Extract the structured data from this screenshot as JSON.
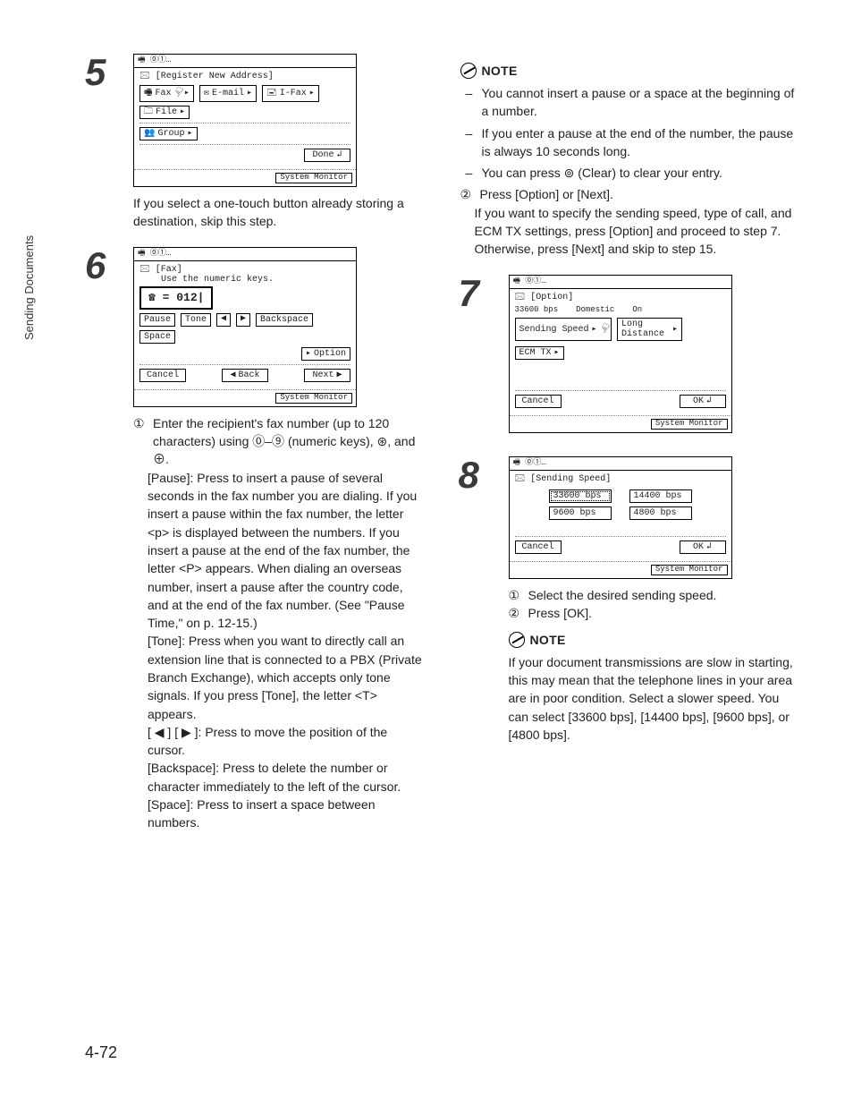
{
  "side_tab": "Sending Documents",
  "page_number": "4-72",
  "left": {
    "step5": {
      "num": "5",
      "screen_title": "[Register New Address]",
      "btn_fax": "Fax",
      "btn_email": "E-mail",
      "btn_ifax": "I-Fax",
      "btn_file": "File",
      "btn_group": "Group",
      "btn_done": "Done",
      "sysmon": "System Monitor",
      "caption": "If you select a one-touch button already storing a destination, skip this step."
    },
    "step6": {
      "num": "6",
      "screen_lbl1": "[Fax]",
      "screen_lbl2": "Use the numeric keys.",
      "dial_prefix": "☎ = ",
      "dial_value": "012",
      "btn_pause": "Pause",
      "btn_tone": "Tone",
      "btn_left": "◀",
      "btn_right": "▶",
      "btn_backspace": "Backspace",
      "btn_space": "Space",
      "btn_option": "Option",
      "btn_cancel": "Cancel",
      "btn_back": "Back",
      "btn_next": "Next",
      "sysmon": "System Monitor",
      "li1_n": "①",
      "li1": "Enter the recipient's fax number (up to 120 characters) using ⓪–⑨ (numeric keys), ⊛, and ⊕.",
      "pause_lbl": "[Pause]: Press to insert a pause of several seconds in the fax number you are dialing. If you insert a pause within the fax number, the letter <p> is displayed between the numbers. If you insert a pause at the end of the fax number, the letter <P> appears. When dialing an overseas number, insert a pause after the country code, and at the end of the fax number. (See \"Pause Time,\" on p. 12-15.)",
      "tone_lbl": "[Tone]: Press when you want to directly call an extension line that is connected to a PBX (Private Branch Exchange), which accepts only tone signals. If you press [Tone], the letter <T> appears.",
      "arrows_lbl": "[ ◀ ] [ ▶ ]: Press to move the position of the cursor.",
      "bksp_lbl": "[Backspace]: Press to delete the number or character immediately to the left of the cursor.",
      "space_lbl": "[Space]: Press to insert a space between numbers."
    }
  },
  "right": {
    "note1": {
      "label": "NOTE",
      "d1": "You cannot insert a pause or a space at the beginning of a number.",
      "d2": "If you enter a pause at the end of the number, the pause is always 10 seconds long.",
      "d3": "You can press ⊚ (Clear) to clear your entry."
    },
    "li2_n": "②",
    "li2a": "Press [Option] or [Next].",
    "li2b": "If you want to specify the sending speed, type of call, and ECM TX settings, press [Option] and proceed to step 7. Otherwise, press [Next] and skip to step 15.",
    "step7": {
      "num": "7",
      "screen_title": "[Option]",
      "row_speed": "33600 bps",
      "row_type": "Domestic",
      "row_ecm": "On",
      "btn_sendspeed": "Sending Speed",
      "btn_long": "Long\nDistance",
      "btn_ecmtx": "ECM TX",
      "btn_cancel": "Cancel",
      "btn_ok": "OK",
      "sysmon": "System Monitor"
    },
    "step8": {
      "num": "8",
      "screen_title": "[Sending Speed]",
      "b1": "33600 bps",
      "b2": "14400 bps",
      "b3": "9600 bps",
      "b4": "4800 bps",
      "btn_cancel": "Cancel",
      "btn_ok": "OK",
      "sysmon": "System Monitor",
      "li1_n": "①",
      "li1": "Select the desired sending speed.",
      "li2_n": "②",
      "li2": "Press [OK]."
    },
    "note2": {
      "label": "NOTE",
      "text": "If your document transmissions are slow in starting, this may mean that the telephone lines in your area are in poor condition. Select a slower speed. You can select [33600 bps], [14400 bps], [9600 bps], or [4800 bps]."
    }
  }
}
